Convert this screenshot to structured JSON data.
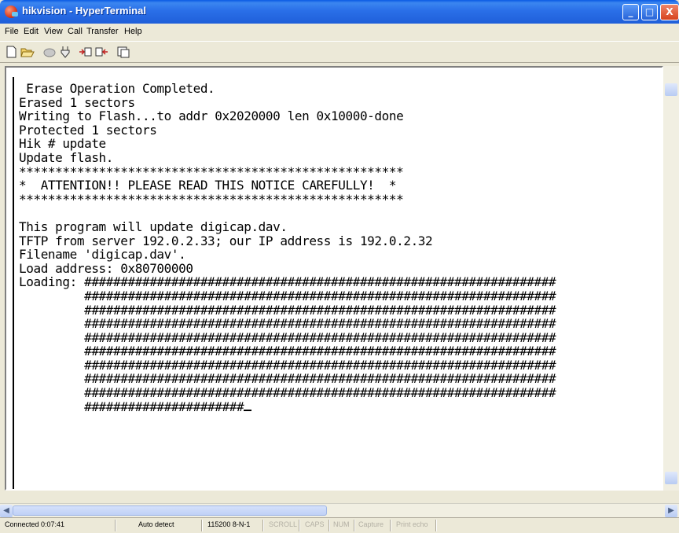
{
  "window": {
    "title": "hikvision - HyperTerminal",
    "buttons": {
      "minimize": "_",
      "maximize": "□",
      "close": "X"
    }
  },
  "menu": [
    "File",
    "Edit",
    "View",
    "Call",
    "Transfer",
    "Help"
  ],
  "toolbar": [
    "new-connection-icon",
    "open-icon",
    "disconnect-icon",
    "dial-icon",
    "send-icon",
    "receive-icon",
    "properties-icon"
  ],
  "terminal": {
    "lines": [
      " Erase Operation Completed.",
      "Erased 1 sectors",
      "Writing to Flash...to addr 0x2020000 len 0x10000-done",
      "Protected 1 sectors",
      "Hik # update",
      "Update flash.",
      "*****************************************************",
      "*  ATTENTION!! PLEASE READ THIS NOTICE CAREFULLY!  *",
      "*****************************************************",
      "",
      "This program will update digicap.dav.",
      "TFTP from server 192.0.2.33; our IP address is 192.0.2.32",
      "Filename 'digicap.dav'.",
      "Load address: 0x80700000",
      "Loading: #################################################################",
      "         #################################################################",
      "         #################################################################",
      "         #################################################################",
      "         #################################################################",
      "         #################################################################",
      "         #################################################################",
      "         #################################################################",
      "         #################################################################",
      "         ######################"
    ]
  },
  "status": {
    "connected": "Connected 0:07:41",
    "detect": "Auto detect",
    "settings": "115200 8-N-1",
    "scroll": "SCROLL",
    "caps": "CAPS",
    "num": "NUM",
    "capture": "Capture",
    "print_echo": "Print echo"
  }
}
